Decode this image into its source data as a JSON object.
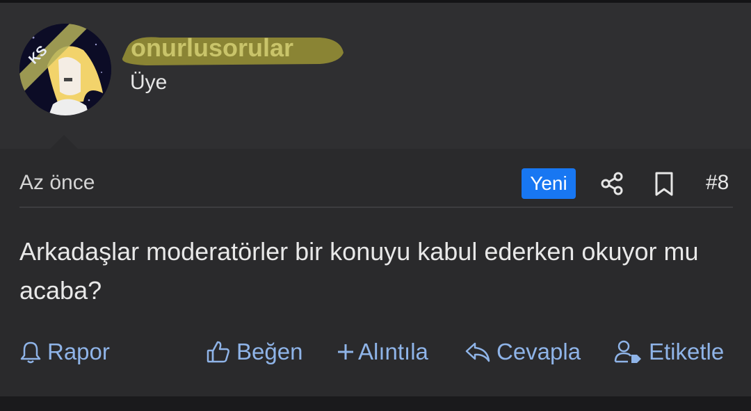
{
  "user": {
    "username": "onurlusorular",
    "role": "Üye",
    "avatar_badge": "KS"
  },
  "post": {
    "time": "Az önce",
    "badge": "Yeni",
    "number": "#8",
    "message": "Arkadaşlar moderatörler bir konuyu kabul ederken okuyor mu acaba?"
  },
  "actions": {
    "report": "Rapor",
    "like": "Beğen",
    "quote": "Alıntıla",
    "reply": "Cevapla",
    "tag": "Etiketle"
  },
  "colors": {
    "accent": "#8fb4e8",
    "badge_bg": "#1877f2",
    "highlight": "#c9c46a"
  }
}
